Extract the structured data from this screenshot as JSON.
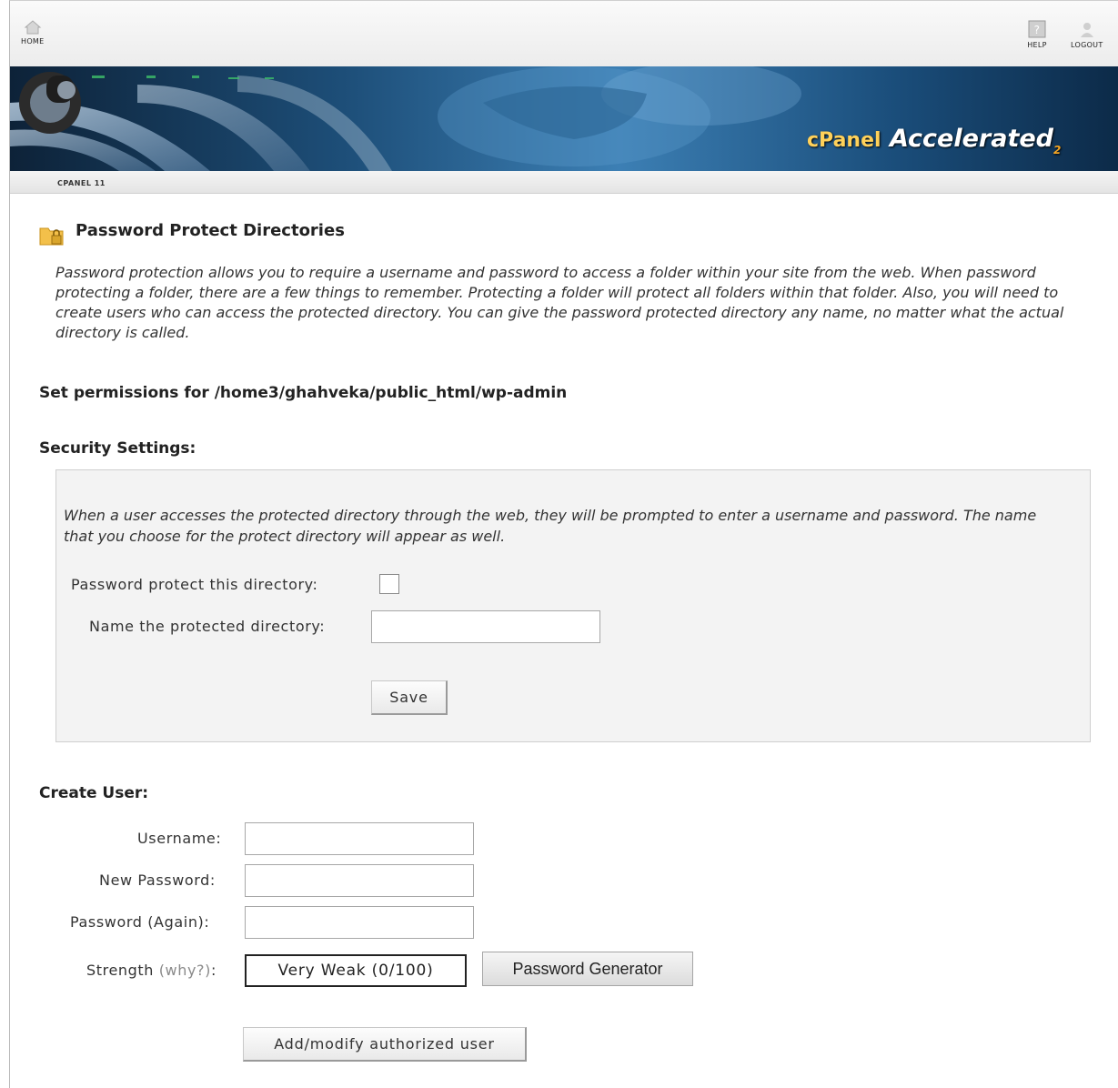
{
  "nav": {
    "home_label": "HOME",
    "help_label": "HELP",
    "logout_label": "LOGOUT"
  },
  "banner": {
    "brand": "cPanel",
    "tagline": "Accelerated",
    "version_sub": "2"
  },
  "breadcrumb": "CPANEL 11",
  "page": {
    "title": "Password Protect Directories",
    "description": "Password protection allows you to require a username and password to access a folder within your site from the web. When password protecting a folder, there are a few things to remember. Protecting a folder will protect all folders within that folder. Also, you will need to create users who can access the protected directory. You can give the password protected directory any name, no matter what the actual directory is called.",
    "permissions_heading": "Set permissions for /home3/ghahveka/public_html/wp-admin"
  },
  "security": {
    "heading": "Security Settings:",
    "description": "When a user accesses the protected directory through the web, they will be prompted to enter a username and password. The name that you choose for the protect directory will appear as well.",
    "protect_label": "Password protect this directory:",
    "protect_checked": false,
    "name_label": "Name the protected directory:",
    "name_value": "",
    "save_label": "Save"
  },
  "create_user": {
    "heading": "Create User:",
    "username_label": "Username:",
    "username_value": "",
    "new_password_label": "New Password:",
    "new_password_value": "",
    "password_again_label": "Password (Again):",
    "password_again_value": "",
    "strength_label": "Strength",
    "why_link": "(why?)",
    "strength_colon": ":",
    "strength_value": "Very Weak (0/100)",
    "generator_label": "Password Generator",
    "submit_label": "Add/modify authorized user"
  },
  "icons": [
    "home-icon",
    "help-icon",
    "logout-icon",
    "cpanel-logo-icon",
    "folder-lock-icon"
  ]
}
